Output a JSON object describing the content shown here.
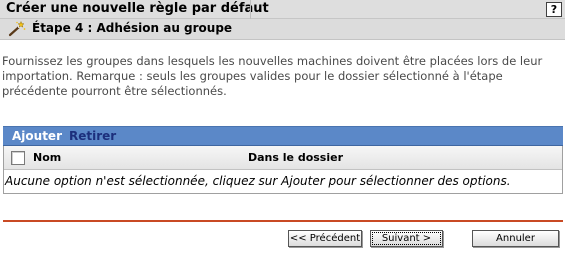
{
  "window": {
    "title": "Créer une nouvelle règle par défaut",
    "help_label": "?"
  },
  "step": {
    "icon": "wizard-wand-icon",
    "title": "Étape 4 : Adhésion au groupe"
  },
  "description": "Fournissez les groupes dans lesquels les nouvelles machines doivent être placées lors de leur importation. Remarque : seuls les groupes valides pour le dossier sélectionné à l'étape précédente pourront être sélectionnés.",
  "actions": {
    "add_label": "Ajouter",
    "remove_label": "Retirer"
  },
  "table": {
    "columns": [
      "Nom",
      "Dans le dossier"
    ],
    "empty_message": "Aucune option n'est sélectionnée, cliquez sur Ajouter pour sélectionner des options."
  },
  "buttons": {
    "previous": "<< Précédent",
    "next": "Suivant >",
    "cancel": "Annuler"
  },
  "colors": {
    "action_bar": "#5b88c8",
    "divider": "#c94a24"
  }
}
